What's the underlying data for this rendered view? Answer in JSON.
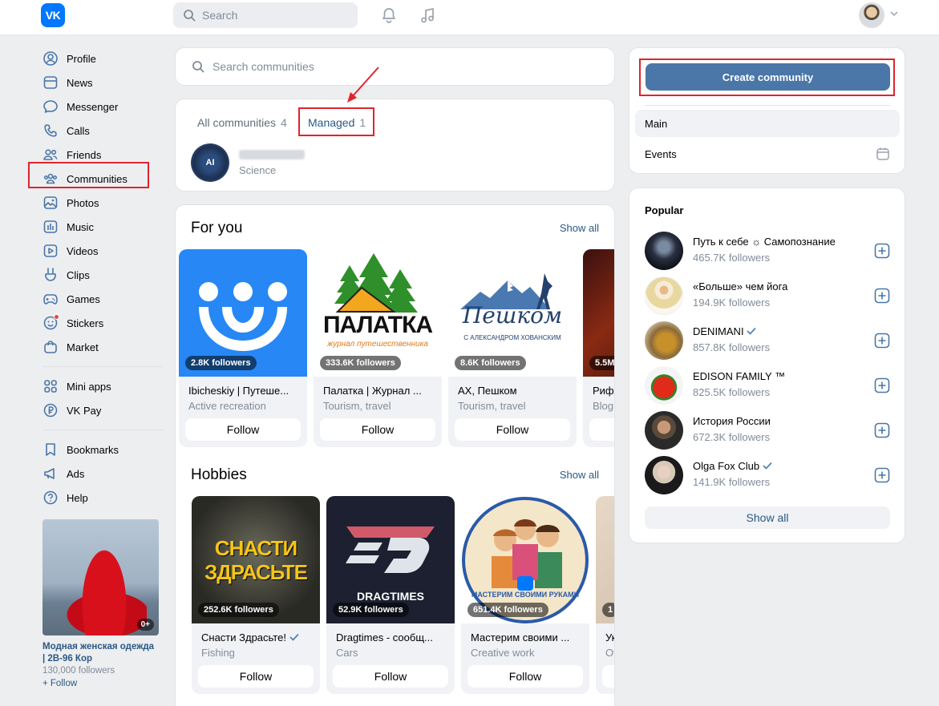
{
  "header": {
    "logo_text": "VK",
    "search_placeholder": "Search"
  },
  "nav": {
    "items": [
      {
        "label": "Profile",
        "icon": "user-circle-icon"
      },
      {
        "label": "News",
        "icon": "news-icon"
      },
      {
        "label": "Messenger",
        "icon": "chat-bubble-icon"
      },
      {
        "label": "Calls",
        "icon": "phone-icon"
      },
      {
        "label": "Friends",
        "icon": "friends-icon"
      },
      {
        "label": "Communities",
        "icon": "communities-icon"
      },
      {
        "label": "Photos",
        "icon": "photo-icon"
      },
      {
        "label": "Music",
        "icon": "music-icon"
      },
      {
        "label": "Videos",
        "icon": "video-icon"
      },
      {
        "label": "Clips",
        "icon": "clips-icon"
      },
      {
        "label": "Games",
        "icon": "gamepad-icon"
      },
      {
        "label": "Stickers",
        "icon": "smiley-icon"
      },
      {
        "label": "Market",
        "icon": "bag-icon"
      }
    ],
    "items2": [
      {
        "label": "Mini apps",
        "icon": "grid-icon"
      },
      {
        "label": "VK Pay",
        "icon": "ruble-icon"
      }
    ],
    "items3": [
      {
        "label": "Bookmarks",
        "icon": "bookmark-icon"
      },
      {
        "label": "Ads",
        "icon": "megaphone-icon"
      },
      {
        "label": "Help",
        "icon": "question-icon"
      }
    ]
  },
  "ad": {
    "age": "0+",
    "title": "Модная женская одежда | 2B-96 Кор",
    "followers": "130,000 followers",
    "follow": "+ Follow"
  },
  "communities": {
    "search_placeholder": "Search communities",
    "tabs": [
      {
        "label": "All communities",
        "count": "4"
      },
      {
        "label": "Managed",
        "count": "1"
      }
    ],
    "managed": {
      "avatar_text": "AI",
      "category": "Science"
    }
  },
  "for_you": {
    "title": "For you",
    "show_all": "Show all",
    "cards": [
      {
        "followers": "2.8K followers",
        "name": "Ibicheskiy | Путеше...",
        "category": "Active recreation",
        "follow": "Follow"
      },
      {
        "followers": "333.6K followers",
        "name": "Палатка | Журнал ...",
        "category": "Tourism, travel",
        "follow": "Follow",
        "logo": "ПАЛАТКА",
        "logo_sub": "журнал путешественника"
      },
      {
        "followers": "8.6K followers",
        "name": "AX, Пешком",
        "category": "Tourism, travel",
        "follow": "Follow",
        "logo": "Пешком",
        "logo_sub": "С АЛЕКСАНДРОМ ХОВАНСКИМ"
      },
      {
        "followers": "5.5M",
        "name": "Риф",
        "category": "Blog",
        "follow": ""
      }
    ]
  },
  "hobbies": {
    "title": "Hobbies",
    "show_all": "Show all",
    "cards": [
      {
        "followers": "252.6K followers",
        "name": "Снасти Здрасьте!",
        "category": "Fishing",
        "follow": "Follow",
        "logo1": "СНАСТИ",
        "logo2": "ЗДРАСЬТЕ"
      },
      {
        "followers": "52.9K followers",
        "name": "Dragtimes - сообщ...",
        "category": "Cars",
        "follow": "Follow",
        "logo": "DRAGTIMES"
      },
      {
        "followers": "651.4K followers",
        "name": "Мастерим своими ...",
        "category": "Creative work",
        "follow": "Follow",
        "logo": "МАСТЕРИМ СВОИМИ РУКАМИ"
      },
      {
        "followers": "1",
        "name": "Ук",
        "category": "Ot",
        "follow": ""
      }
    ]
  },
  "right": {
    "create_label": "Create community",
    "menu": [
      {
        "label": "Main"
      },
      {
        "label": "Events"
      }
    ],
    "popular_title": "Popular",
    "popular": [
      {
        "name": "Путь к себе ☼ Самопознание",
        "followers": "465.7K followers",
        "verified": false
      },
      {
        "name": "«Больше» чем йога",
        "followers": "194.9K followers",
        "verified": false
      },
      {
        "name": "DENIMANI",
        "followers": "857.8K followers",
        "verified": true
      },
      {
        "name": "EDISON FAMILY ™",
        "followers": "825.5K followers",
        "verified": false
      },
      {
        "name": "История России",
        "followers": "672.3K followers",
        "verified": false
      },
      {
        "name": "Olga Fox Club",
        "followers": "141.9K followers",
        "verified": true
      }
    ],
    "show_all": "Show all"
  },
  "colors": {
    "accent": "#4a76a8",
    "link": "#2a5885",
    "highlight": "#e0242d",
    "vk_blue": "#0077ff"
  }
}
